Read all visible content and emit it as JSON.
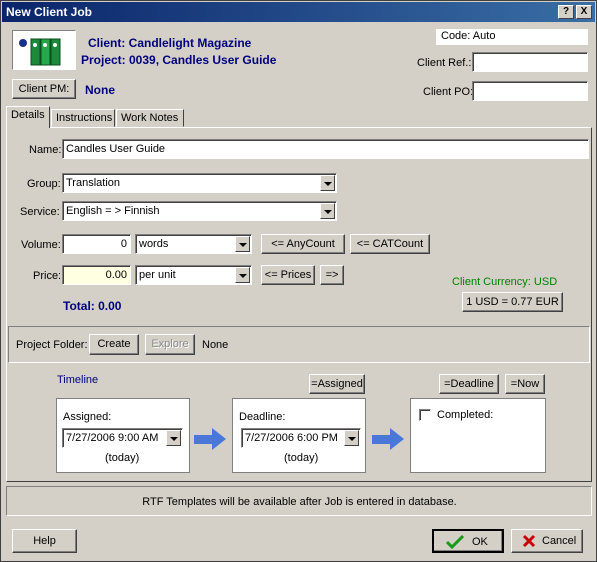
{
  "window": {
    "title": "New Client Job",
    "help_glyph": "?",
    "close_glyph": "X"
  },
  "header": {
    "client_line": "Client: Candlelight Magazine",
    "project_line": "Project: 0039, Candles User Guide",
    "code_label": "Code: Auto",
    "client_ref_label": "Client Ref.:",
    "client_ref_value": "",
    "client_po_label": "Client PO:",
    "client_po_value": "",
    "client_pm_button": "Client PM:",
    "client_pm_value": "None"
  },
  "tabs": [
    "Details",
    "Instructions",
    "Work Notes"
  ],
  "details": {
    "name_label": "Name:",
    "name_value": "Candles User Guide",
    "group_label": "Group:",
    "group_value": "Translation",
    "service_label": "Service:",
    "service_value": "English = > Finnish",
    "volume_label": "Volume:",
    "volume_value": "0",
    "volume_unit": "words",
    "anycount_button": "<= AnyCount",
    "catcount_button": "<= CATCount",
    "price_label": "Price:",
    "price_value": "0.00",
    "price_unit": "per unit",
    "prices_button": "<= Prices",
    "arrow_button": "=>",
    "total": "Total: 0.00",
    "client_currency": "Client Currency: USD",
    "rate_button": "1 USD = 0.77 EUR",
    "project_folder_label": "Project Folder:",
    "create_button": "Create",
    "explore_button": "Explore",
    "folder_value": "None",
    "timeline_label": "Timeline",
    "assigned_button": "=Assigned",
    "deadline_button": "=Deadline",
    "now_button": "=Now",
    "assigned_label": "Assigned:",
    "assigned_value": "7/27/2006 9:00 AM",
    "assigned_note": "(today)",
    "deadline_label": "Deadline:",
    "deadline_value": "7/27/2006 6:00 PM",
    "deadline_note": "(today)",
    "completed_label": "Completed:"
  },
  "footer": {
    "rtf_notice": "RTF Templates will be available after Job is entered in database.",
    "help_button": "Help",
    "ok_button": "OK",
    "cancel_button": "Cancel"
  },
  "colors": {
    "client_text": "#00007f",
    "currency_text": "#008000",
    "arrow": "#4a78d8",
    "ok_check": "#1a9a1a",
    "cancel_x": "#cc0000"
  }
}
